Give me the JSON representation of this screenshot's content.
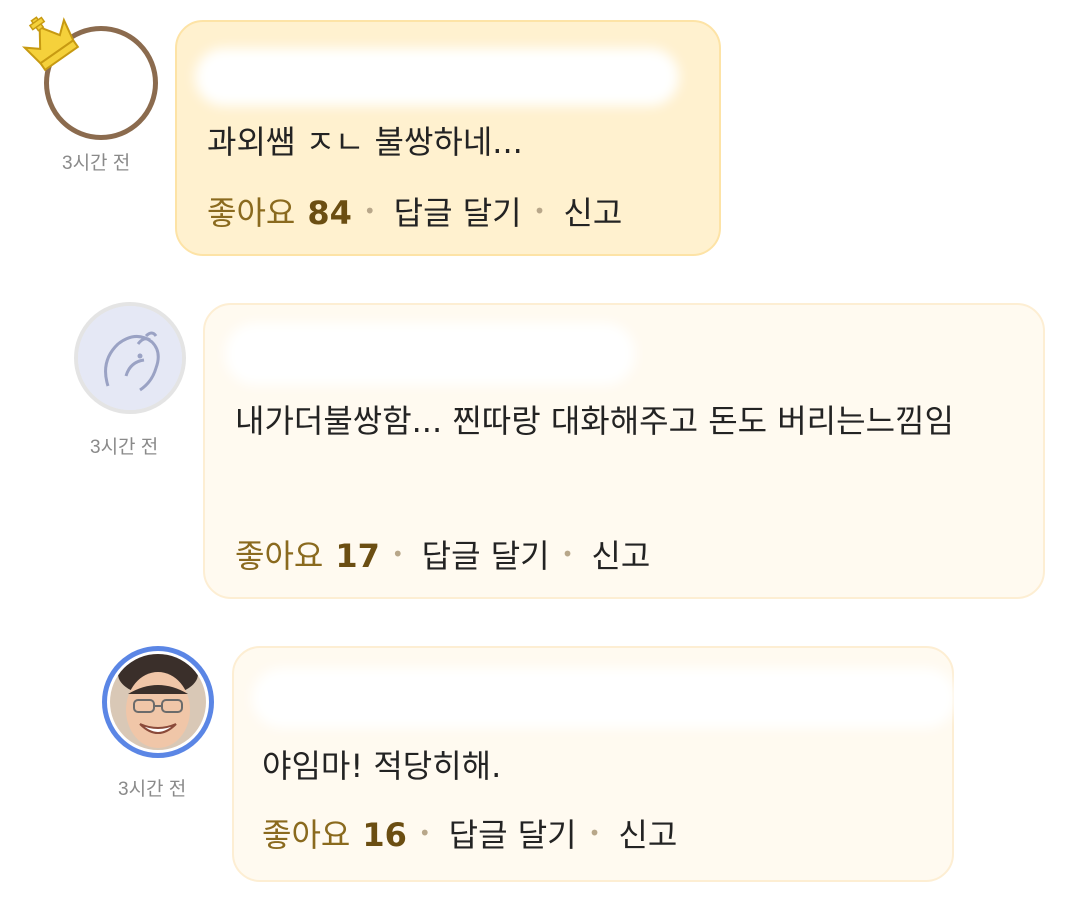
{
  "comments": [
    {
      "time": "3시간 전",
      "text": "과외쌤 ㅈㄴ 불쌍하네...",
      "like_label": "좋아요",
      "like_count": "84",
      "reply_label": "답글 달기",
      "report_label": "신고"
    },
    {
      "time": "3시간 전",
      "text": "내가더불쌍함... 찐따랑 대화해주고 돈도 버리는느낌임",
      "like_label": "좋아요",
      "like_count": "17",
      "reply_label": "답글 달기",
      "report_label": "신고"
    },
    {
      "time": "3시간 전",
      "text": "야임마! 적당히해.",
      "like_label": "좋아요",
      "like_count": "16",
      "reply_label": "답글 달기",
      "report_label": "신고"
    }
  ],
  "icons": {
    "crown": "crown-icon",
    "dot": "separator-dot-icon"
  },
  "colors": {
    "bubble_gold": "#fff1cf",
    "bubble_light": "#fffaf0",
    "like": "#6b4e12",
    "avatar_ring_blue": "#5b86e5"
  }
}
